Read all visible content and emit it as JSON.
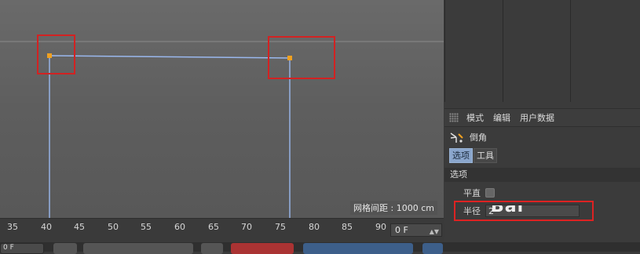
{
  "viewport": {
    "grid_readout": "网格间距 : 1000 cm"
  },
  "attributes": {
    "menu": [
      "模式",
      "编辑",
      "用户数据"
    ],
    "object_name": "倒角",
    "tabs": [
      {
        "label": "选项",
        "active": true
      },
      {
        "label": "工具",
        "active": false
      }
    ],
    "section": "选项",
    "flat_label": "平直",
    "flat_checked": false,
    "radius_label": "半径",
    "radius_value": "2",
    "watermark": "Bai"
  },
  "timeline": {
    "ticks": [
      "35",
      "40",
      "45",
      "50",
      "55",
      "60",
      "65",
      "70",
      "75",
      "80",
      "85",
      "90"
    ],
    "current_frame": "0 F",
    "left_field": "0 F"
  },
  "colors": {
    "accent": "#8aa6cc",
    "highlight_box": "#d22222",
    "spline": "#8fb0e6",
    "point": "#f0a020"
  }
}
